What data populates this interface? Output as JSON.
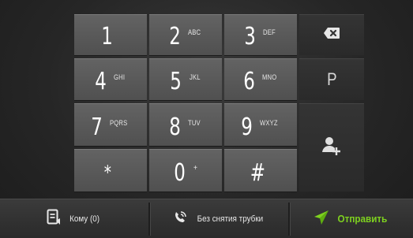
{
  "keys": [
    {
      "digit": "1",
      "letters": ""
    },
    {
      "digit": "2",
      "letters": "ABC"
    },
    {
      "digit": "3",
      "letters": "DEF"
    },
    {
      "digit": "4",
      "letters": "GHI"
    },
    {
      "digit": "5",
      "letters": "JKL"
    },
    {
      "digit": "6",
      "letters": "MNO"
    },
    {
      "digit": "7",
      "letters": "PQRS"
    },
    {
      "digit": "8",
      "letters": "TUV"
    },
    {
      "digit": "9",
      "letters": "WXYZ"
    },
    {
      "digit": "*",
      "letters": ""
    },
    {
      "digit": "0",
      "letters": "+"
    },
    {
      "digit": "#",
      "letters": ""
    }
  ],
  "side": {
    "backspace_icon": "backspace-icon",
    "pause_label": "P",
    "add_contact_icon": "add-contact-icon"
  },
  "bottom_bar": {
    "to_label": "Кому (0)",
    "to_icon": "recipients-card-icon",
    "handsfree_label": "Без снятия трубки",
    "handsfree_icon": "phone-ringing-icon",
    "send_label": "Отправить",
    "send_icon": "send-arrow-icon",
    "send_color": "#7ed11f"
  }
}
